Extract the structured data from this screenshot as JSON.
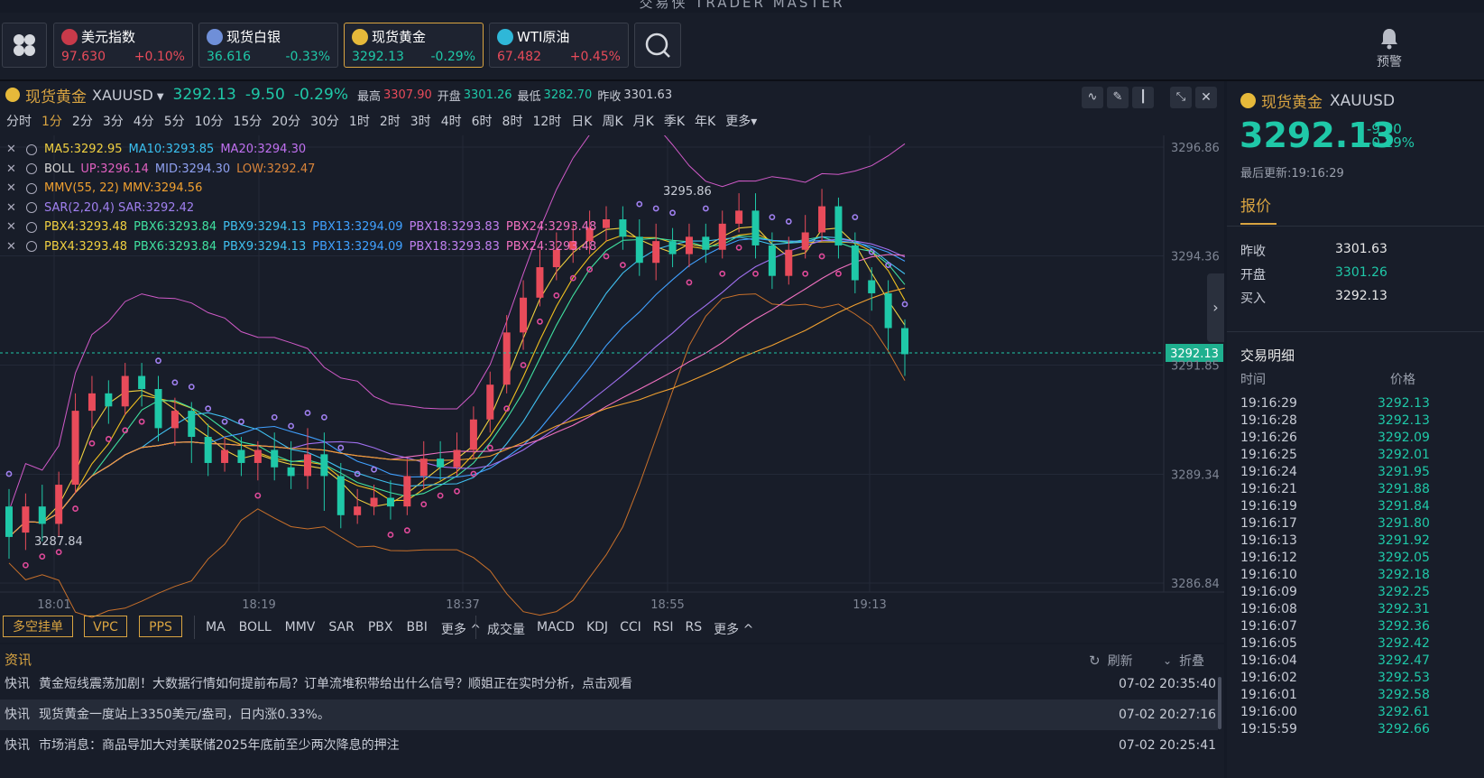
{
  "app_title": "交易侠 TRADER MASTER",
  "tickers": [
    {
      "name": "美元指数",
      "price": "97.630",
      "change": "+0.10%",
      "dir": "up",
      "flag_color": "#c83a4a"
    },
    {
      "name": "现货白银",
      "price": "36.616",
      "change": "-0.33%",
      "dir": "dn",
      "flag_color": "#6f8fd8"
    },
    {
      "name": "现货黄金",
      "price": "3292.13",
      "change": "-0.29%",
      "dir": "dn",
      "flag_color": "#e6b93a"
    },
    {
      "name": "WTI原油",
      "price": "67.482",
      "change": "+0.45%",
      "dir": "up",
      "flag_color": "#2fb7d8"
    }
  ],
  "alert_label": "预警",
  "chart_header": {
    "symbol_name": "现货黄金",
    "symbol_code": "XAUUSD",
    "price": "3292.13",
    "change": "-9.50",
    "change_pct": "-0.29%",
    "high_label": "最高",
    "high": "3307.90",
    "open_label": "开盘",
    "open": "3301.26",
    "low_label": "最低",
    "low": "3282.70",
    "prev_label": "昨收",
    "prev": "3301.63"
  },
  "timeframes": [
    "分时",
    "1分",
    "2分",
    "3分",
    "4分",
    "5分",
    "10分",
    "15分",
    "20分",
    "30分",
    "1时",
    "2时",
    "3时",
    "4时",
    "6时",
    "8时",
    "12时",
    "日K",
    "周K",
    "月K",
    "季K",
    "年K",
    "更多"
  ],
  "active_timeframe": "1分",
  "indicators": [
    {
      "parts": [
        {
          "t": "MA5:3292.95",
          "c": "#f0d040"
        },
        {
          "t": "MA10:3293.85",
          "c": "#3ac0f0"
        },
        {
          "t": "MA20:3294.30",
          "c": "#c070f0"
        }
      ]
    },
    {
      "parts": [
        {
          "t": "BOLL",
          "c": "#d8d8d8"
        },
        {
          "t": "UP:3296.14",
          "c": "#e060c0"
        },
        {
          "t": "MID:3294.30",
          "c": "#8fa0f0"
        },
        {
          "t": "LOW:3292.47",
          "c": "#d8843a"
        }
      ]
    },
    {
      "parts": [
        {
          "t": "MMV(55, 22) MMV:3294.56",
          "c": "#f0a030"
        }
      ]
    },
    {
      "parts": [
        {
          "t": "SAR(2,20,4) SAR:3292.42",
          "c": "#a080f0"
        }
      ]
    },
    {
      "parts": [
        {
          "t": "PBX4:3293.48",
          "c": "#f0d040"
        },
        {
          "t": "PBX6:3293.84",
          "c": "#40e0a0"
        },
        {
          "t": "PBX9:3294.13",
          "c": "#40c0f0"
        },
        {
          "t": "PBX13:3294.09",
          "c": "#40a0ff"
        },
        {
          "t": "PBX18:3293.83",
          "c": "#c080f0"
        },
        {
          "t": "PBX24:3293.48",
          "c": "#f070c0"
        }
      ]
    },
    {
      "parts": [
        {
          "t": "PBX4:3293.48",
          "c": "#f0d040"
        },
        {
          "t": "PBX6:3293.84",
          "c": "#40e0a0"
        },
        {
          "t": "PBX9:3294.13",
          "c": "#40c0f0"
        },
        {
          "t": "PBX13:3294.09",
          "c": "#40a0ff"
        },
        {
          "t": "PBX18:3293.83",
          "c": "#c080f0"
        },
        {
          "t": "PBX24:3293.48",
          "c": "#f070c0"
        }
      ]
    }
  ],
  "price_axis": [
    "3296.86",
    "3294.36",
    "3291.85",
    "3289.34",
    "3286.84"
  ],
  "current_price_tag": "3292.13",
  "time_axis": [
    "18:01",
    "18:19",
    "18:37",
    "18:55",
    "19:13"
  ],
  "chart_annotations": {
    "max": "3295.86",
    "min": "3287.84"
  },
  "bottom_buttons": [
    "多空挂单",
    "VPC",
    "PPS"
  ],
  "main_indicators": [
    "MA",
    "BOLL",
    "MMV",
    "SAR",
    "PBX",
    "BBI",
    "更多"
  ],
  "sub_indicators": [
    "成交量",
    "MACD",
    "KDJ",
    "CCI",
    "RSI",
    "RS",
    "更多"
  ],
  "news": {
    "title": "资讯",
    "refresh": "刷新",
    "collapse": "折叠",
    "items": [
      {
        "tag": "快讯",
        "text": "黄金短线震荡加剧！大数据行情如何提前布局？订单流堆积带给出什么信号？顺姐正在实时分析，点击观看",
        "time": "07-02 20:35:40"
      },
      {
        "tag": "快讯",
        "text": "现货黄金一度站上3350美元/盎司，日内涨0.33%。",
        "time": "07-02 20:27:16"
      },
      {
        "tag": "快讯",
        "text": "市场消息：商品导加大对美联储2025年底前至少两次降息的押注",
        "time": "07-02 20:25:41"
      }
    ]
  },
  "quote_panel": {
    "symbol_name": "现货黄金",
    "symbol_code": "XAUUSD",
    "price": "3292.13",
    "change": "-9.50",
    "change_pct": "-0.29%",
    "updated": "最后更新:19:16:29",
    "tab": "报价",
    "rows": [
      {
        "label": "昨收",
        "value": "3301.63",
        "color": "#e8e8e8"
      },
      {
        "label": "开盘",
        "value": "3301.26",
        "color": "#1fc8a8"
      },
      {
        "label": "买入",
        "value": "3292.13",
        "color": "#e8e8e8"
      }
    ],
    "trades_title": "交易明细",
    "col_time": "时间",
    "col_price": "价格",
    "trades": [
      {
        "t": "19:16:29",
        "p": "3292.13"
      },
      {
        "t": "19:16:28",
        "p": "3292.13"
      },
      {
        "t": "19:16:26",
        "p": "3292.09"
      },
      {
        "t": "19:16:25",
        "p": "3292.01"
      },
      {
        "t": "19:16:24",
        "p": "3291.95"
      },
      {
        "t": "19:16:21",
        "p": "3291.88"
      },
      {
        "t": "19:16:19",
        "p": "3291.84"
      },
      {
        "t": "19:16:17",
        "p": "3291.80"
      },
      {
        "t": "19:16:13",
        "p": "3291.92"
      },
      {
        "t": "19:16:12",
        "p": "3292.05"
      },
      {
        "t": "19:16:10",
        "p": "3292.18"
      },
      {
        "t": "19:16:09",
        "p": "3292.25"
      },
      {
        "t": "19:16:08",
        "p": "3292.31"
      },
      {
        "t": "19:16:07",
        "p": "3292.36"
      },
      {
        "t": "19:16:05",
        "p": "3292.42"
      },
      {
        "t": "19:16:04",
        "p": "3292.47"
      },
      {
        "t": "19:16:02",
        "p": "3292.53"
      },
      {
        "t": "19:16:01",
        "p": "3292.58"
      },
      {
        "t": "19:16:00",
        "p": "3292.61"
      },
      {
        "t": "19:15:59",
        "p": "3292.66"
      }
    ]
  },
  "colors": {
    "up": "#e84b5a",
    "down": "#1fc8a8",
    "accent": "#d9a441",
    "bg": "#181d29"
  },
  "candles": [
    [
      3288.6,
      3287.9,
      3289.0,
      3287.4
    ],
    [
      3288.0,
      3288.6,
      3288.9,
      3287.6
    ],
    [
      3288.6,
      3288.2,
      3289.1,
      3287.8
    ],
    [
      3288.2,
      3289.1,
      3289.4,
      3287.9
    ],
    [
      3289.1,
      3290.8,
      3291.2,
      3288.9
    ],
    [
      3290.8,
      3291.2,
      3291.6,
      3290.4
    ],
    [
      3291.2,
      3290.9,
      3291.5,
      3290.5
    ],
    [
      3290.9,
      3291.6,
      3291.9,
      3290.7
    ],
    [
      3291.6,
      3291.3,
      3291.9,
      3290.9
    ],
    [
      3291.3,
      3290.4,
      3291.6,
      3290.1
    ],
    [
      3290.4,
      3290.8,
      3291.1,
      3290.0
    ],
    [
      3290.8,
      3290.2,
      3291.0,
      3289.6
    ],
    [
      3290.2,
      3289.6,
      3290.5,
      3289.3
    ],
    [
      3289.6,
      3289.9,
      3290.2,
      3289.4
    ],
    [
      3289.9,
      3289.6,
      3290.2,
      3289.3
    ],
    [
      3289.6,
      3289.9,
      3290.1,
      3289.2
    ],
    [
      3289.9,
      3289.5,
      3290.3,
      3289.2
    ],
    [
      3289.5,
      3289.3,
      3290.1,
      3289.0
    ],
    [
      3289.3,
      3289.8,
      3290.4,
      3289.0
    ],
    [
      3289.8,
      3289.3,
      3290.3,
      3288.5
    ],
    [
      3289.3,
      3288.4,
      3289.6,
      3288.1
    ],
    [
      3288.4,
      3288.6,
      3289.0,
      3288.2
    ],
    [
      3288.6,
      3288.8,
      3289.1,
      3288.4
    ],
    [
      3288.8,
      3288.6,
      3289.2,
      3288.3
    ],
    [
      3288.6,
      3289.3,
      3289.7,
      3288.4
    ],
    [
      3289.3,
      3289.7,
      3290.1,
      3289.0
    ],
    [
      3289.7,
      3289.5,
      3290.1,
      3289.2
    ],
    [
      3289.5,
      3289.9,
      3290.3,
      3289.3
    ],
    [
      3289.9,
      3290.6,
      3290.9,
      3289.7
    ],
    [
      3290.6,
      3291.4,
      3291.7,
      3290.3
    ],
    [
      3291.4,
      3292.6,
      3293.0,
      3291.2
    ],
    [
      3292.6,
      3293.4,
      3293.8,
      3292.2
    ],
    [
      3293.4,
      3294.1,
      3294.5,
      3293.2
    ],
    [
      3294.1,
      3294.5,
      3294.9,
      3293.8
    ],
    [
      3294.5,
      3294.7,
      3295.1,
      3294.2
    ],
    [
      3294.7,
      3295.0,
      3295.4,
      3294.4
    ],
    [
      3295.0,
      3295.2,
      3295.5,
      3294.7
    ],
    [
      3295.2,
      3294.8,
      3295.5,
      3294.5
    ],
    [
      3294.8,
      3294.2,
      3295.2,
      3293.9
    ],
    [
      3294.2,
      3294.7,
      3295.1,
      3293.8
    ],
    [
      3294.7,
      3294.4,
      3295.0,
      3294.1
    ],
    [
      3294.4,
      3294.8,
      3295.1,
      3294.1
    ],
    [
      3294.8,
      3294.5,
      3295.1,
      3294.2
    ],
    [
      3294.5,
      3295.1,
      3295.4,
      3294.3
    ],
    [
      3295.1,
      3295.4,
      3295.8,
      3294.9
    ],
    [
      3295.4,
      3294.6,
      3295.8,
      3294.3
    ],
    [
      3294.6,
      3293.9,
      3294.9,
      3293.6
    ],
    [
      3293.9,
      3294.5,
      3294.8,
      3293.7
    ],
    [
      3294.5,
      3294.9,
      3295.3,
      3294.3
    ],
    [
      3294.9,
      3295.5,
      3295.9,
      3294.7
    ],
    [
      3295.5,
      3294.6,
      3295.7,
      3294.3
    ],
    [
      3294.6,
      3293.8,
      3294.9,
      3293.5
    ],
    [
      3293.8,
      3293.5,
      3294.1,
      3293.1
    ],
    [
      3293.5,
      3292.7,
      3293.8,
      3292.2
    ],
    [
      3292.7,
      3292.1,
      3292.9,
      3291.6
    ]
  ]
}
